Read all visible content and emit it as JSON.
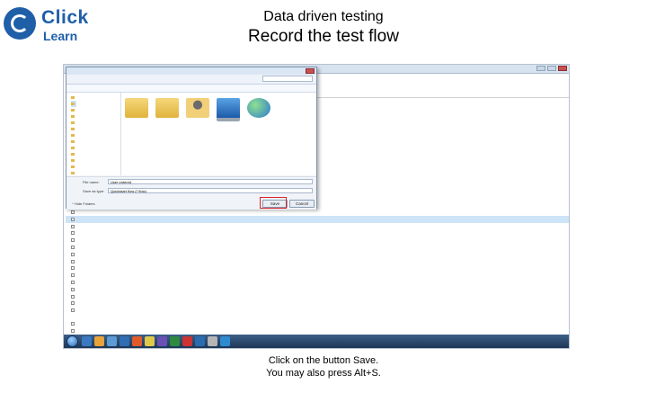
{
  "brand": {
    "click": "Click",
    "learn": "Learn",
    "color": "#1f5fa8"
  },
  "slide": {
    "title": "Data driven testing",
    "subtitle": "Record the test flow",
    "footer_line1": "Click on the button Save.",
    "footer_line2": "You may also press Alt+S."
  },
  "dialog": {
    "file_name_label": "File name:",
    "file_name_value": "User entered",
    "save_as_type_label": "Save as type:",
    "save_as_type_value": "Quickstart flow (*.flow)",
    "hide_folders": "Hide Folders",
    "save_button": "Save",
    "cancel_button": "Cancel"
  },
  "colors": {
    "highlight": "#d9232a",
    "taskbar": "#1e3656",
    "selection": "#cde3f8"
  },
  "icons": [
    "folder-icon",
    "user-folder-icon",
    "computer-icon",
    "network-icon",
    "start-orb-icon"
  ]
}
